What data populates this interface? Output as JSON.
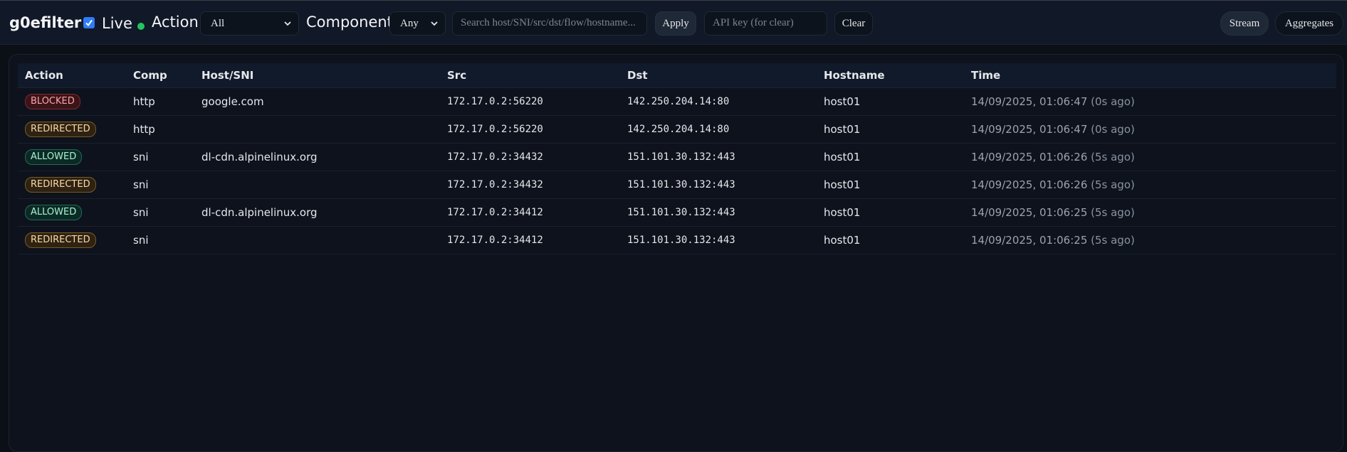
{
  "header": {
    "brand": "g0efilter",
    "live_label": "Live",
    "live_checked": true,
    "action_label": "Action",
    "action_select_value": "All",
    "component_label": "Component",
    "component_select_value": "Any",
    "search_placeholder": "Search host/SNI/src/dst/flow/hostname...",
    "apply_label": "Apply",
    "apikey_placeholder": "API key (for clear)",
    "clear_label": "Clear",
    "stream_label": "Stream",
    "aggregates_label": "Aggregates"
  },
  "colors": {
    "live_dot": "#22c55e",
    "blocked": "#fca5a5",
    "redirected": "#fcd9a6",
    "allowed": "#a7f3d0"
  },
  "table": {
    "columns": [
      "Action",
      "Comp",
      "Host/SNI",
      "Src",
      "Dst",
      "Hostname",
      "Time"
    ],
    "rows": [
      {
        "action": "BLOCKED",
        "comp": "http",
        "host": "google.com",
        "src": "172.17.0.2:56220",
        "dst": "142.250.204.14:80",
        "hostname": "host01",
        "time": "14/09/2025, 01:06:47",
        "ago": "(0s ago)"
      },
      {
        "action": "REDIRECTED",
        "comp": "http",
        "host": "",
        "src": "172.17.0.2:56220",
        "dst": "142.250.204.14:80",
        "hostname": "host01",
        "time": "14/09/2025, 01:06:47",
        "ago": "(0s ago)"
      },
      {
        "action": "ALLOWED",
        "comp": "sni",
        "host": "dl-cdn.alpinelinux.org",
        "src": "172.17.0.2:34432",
        "dst": "151.101.30.132:443",
        "hostname": "host01",
        "time": "14/09/2025, 01:06:26",
        "ago": "(5s ago)"
      },
      {
        "action": "REDIRECTED",
        "comp": "sni",
        "host": "",
        "src": "172.17.0.2:34432",
        "dst": "151.101.30.132:443",
        "hostname": "host01",
        "time": "14/09/2025, 01:06:26",
        "ago": "(5s ago)"
      },
      {
        "action": "ALLOWED",
        "comp": "sni",
        "host": "dl-cdn.alpinelinux.org",
        "src": "172.17.0.2:34412",
        "dst": "151.101.30.132:443",
        "hostname": "host01",
        "time": "14/09/2025, 01:06:25",
        "ago": "(5s ago)"
      },
      {
        "action": "REDIRECTED",
        "comp": "sni",
        "host": "",
        "src": "172.17.0.2:34412",
        "dst": "151.101.30.132:443",
        "hostname": "host01",
        "time": "14/09/2025, 01:06:25",
        "ago": "(5s ago)"
      }
    ]
  }
}
